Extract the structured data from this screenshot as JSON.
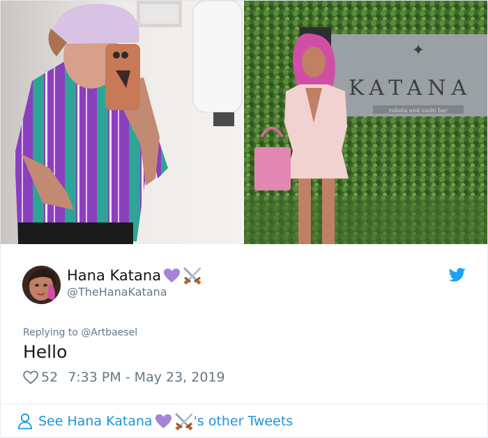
{
  "photos": {
    "sign_text": "KATANA",
    "sign_subtext": "robata and sushi bar"
  },
  "tweet": {
    "display_name": "Hana Katana",
    "name_emojis": [
      "purple-heart",
      "crossed-swords"
    ],
    "handle": "@TheHanaKatana",
    "replying_prefix": "Replying to",
    "replying_to": "@Artbaesel",
    "text": "Hello",
    "like_count": "52",
    "timestamp": "7:33 PM - May 23, 2019"
  },
  "footer": {
    "see_prefix": "See",
    "name": "Hana Katana",
    "suffix": "'s other Tweets"
  },
  "colors": {
    "link": "#1b95e0",
    "muted": "#657786",
    "text": "#14171a",
    "twitter_blue": "#1da1f2",
    "heart_emoji": "#a783d8"
  },
  "icons": [
    "twitter-bird-icon",
    "like-heart-icon",
    "person-icon"
  ]
}
